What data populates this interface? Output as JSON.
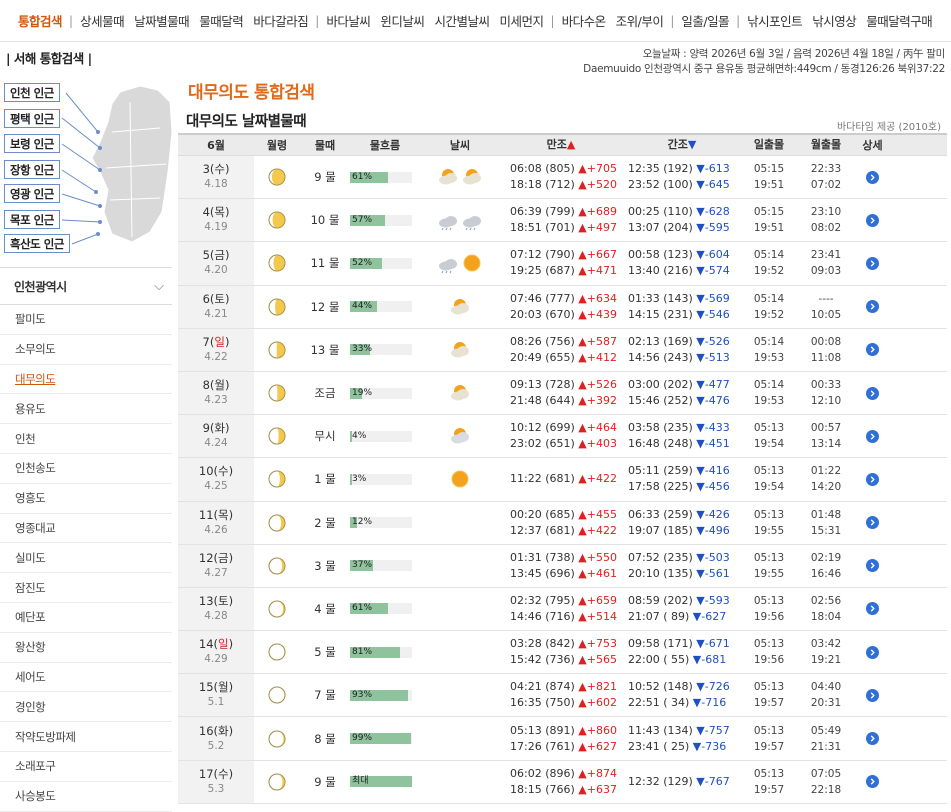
{
  "nav": [
    "통합검색",
    "상세물때",
    "날짜별물때",
    "물때달력",
    "바다갈라짐",
    "바다날씨",
    "윈디날씨",
    "시간별날씨",
    "미세먼지",
    "바다수온",
    "조위/부이",
    "일출/일몰",
    "낚시포인트",
    "낚시영상",
    "물때달력구매"
  ],
  "sidebar": {
    "title": "서해 통합검색",
    "map_labels": [
      "인천 인근",
      "평택 인근",
      "보령 인근",
      "장항 인근",
      "영광 인근",
      "목포 인근",
      "흑산도 인근"
    ],
    "region": "인천광역시",
    "locations": [
      "팔미도",
      "소무의도",
      "대무의도",
      "용유도",
      "인천",
      "인천송도",
      "영흥도",
      "영종대교",
      "실미도",
      "잠진도",
      "예단포",
      "왕산항",
      "세어도",
      "경인항",
      "작약도방파제",
      "소래포구",
      "사승봉도"
    ]
  },
  "header": {
    "date_line": "오늘날짜 : 양력 2026년 6월 3일 / 음력 2026년 4월 18일 / 丙午 팔미",
    "loc_line": "Daemuuido 인천광역시 중구 용유동 평균해면하:449cm / 동경126:26 북위37:22",
    "title": "대무의도 통합검색",
    "subtitle": "대무의도 날짜별물때",
    "credit": "바다타임 제공 (2010호)"
  },
  "table": {
    "headers": {
      "month": "6월",
      "moon": "월령",
      "tide": "물때",
      "flow": "물흐름",
      "weather": "날씨",
      "high": "만조",
      "low": "간조",
      "sun": "일출몰",
      "moonrs": "월출몰",
      "detail": "상세"
    },
    "rows": [
      {
        "day": "3(수)",
        "lunar": "4.18",
        "phase": 0.82,
        "tide": "9 물",
        "flow": "61%",
        "flow_pct": 61,
        "wx": [
          "cloud-sun",
          "cloud-sun"
        ],
        "h1": "06:08 (805)",
        "h1c": "▲+705",
        "h2": "18:18 (712)",
        "h2c": "▲+520",
        "l1": "12:35 (192)",
        "l1c": "▼-613",
        "l2": "23:52 (100)",
        "l2c": "▼-645",
        "sunr": "05:15",
        "suns": "19:51",
        "moonr": "22:33",
        "moons": "07:02"
      },
      {
        "day": "4(목)",
        "lunar": "4.19",
        "phase": 0.78,
        "tide": "10 물",
        "flow": "57%",
        "flow_pct": 57,
        "wx": [
          "cloud-rain",
          "cloud-rain"
        ],
        "h1": "06:39 (799)",
        "h1c": "▲+689",
        "h2": "18:51 (701)",
        "h2c": "▲+497",
        "l1": "00:25 (110)",
        "l1c": "▼-628",
        "l2": "13:07 (204)",
        "l2c": "▼-595",
        "sunr": "05:15",
        "suns": "19:51",
        "moonr": "23:10",
        "moons": "08:02"
      },
      {
        "day": "5(금)",
        "lunar": "4.20",
        "phase": 0.72,
        "tide": "11 물",
        "flow": "52%",
        "flow_pct": 52,
        "wx": [
          "cloud-rain",
          "sun"
        ],
        "h1": "07:12 (790)",
        "h1c": "▲+667",
        "h2": "19:25 (687)",
        "h2c": "▲+471",
        "l1": "00:58 (123)",
        "l1c": "▼-604",
        "l2": "13:40 (216)",
        "l2c": "▼-574",
        "sunr": "05:14",
        "suns": "19:52",
        "moonr": "23:41",
        "moons": "09:03"
      },
      {
        "day": "6(토)",
        "lunar": "4.21",
        "phase": 0.62,
        "tide": "12 물",
        "flow": "44%",
        "flow_pct": 44,
        "wx": [
          "cloud-sun"
        ],
        "h1": "07:46 (777)",
        "h1c": "▲+634",
        "h2": "20:03 (670)",
        "h2c": "▲+439",
        "l1": "01:33 (143)",
        "l1c": "▼-569",
        "l2": "14:15 (231)",
        "l2c": "▼-546",
        "sunr": "05:14",
        "suns": "19:52",
        "moonr": "----",
        "moons": "10:05"
      },
      {
        "day": "7(일)",
        "lunar": "4.22",
        "phase": 0.52,
        "tide": "13 물",
        "flow": "33%",
        "flow_pct": 33,
        "wx": [
          "cloud-sun"
        ],
        "h1": "08:26 (756)",
        "h1c": "▲+587",
        "h2": "20:49 (655)",
        "h2c": "▲+412",
        "l1": "02:13 (169)",
        "l1c": "▼-526",
        "l2": "14:56 (243)",
        "l2c": "▼-513",
        "sunr": "05:14",
        "suns": "19:53",
        "moonr": "00:08",
        "moons": "11:08"
      },
      {
        "day": "8(월)",
        "lunar": "4.23",
        "phase": 0.48,
        "tide": "조금",
        "flow": "19%",
        "flow_pct": 19,
        "wx": [
          "cloud-sun"
        ],
        "h1": "09:13 (728)",
        "h1c": "▲+526",
        "h2": "21:48 (644)",
        "h2c": "▲+392",
        "l1": "03:00 (202)",
        "l1c": "▼-477",
        "l2": "15:46 (252)",
        "l2c": "▼-476",
        "sunr": "05:14",
        "suns": "19:53",
        "moonr": "00:33",
        "moons": "12:10"
      },
      {
        "day": "9(화)",
        "lunar": "4.24",
        "phase": 0.4,
        "tide": "무시",
        "flow": "4%",
        "flow_pct": 4,
        "wx": [
          "cloud-sun-gray"
        ],
        "h1": "10:12 (699)",
        "h1c": "▲+464",
        "h2": "23:02 (651)",
        "h2c": "▲+403",
        "l1": "03:58 (235)",
        "l1c": "▼-433",
        "l2": "16:48 (248)",
        "l2c": "▼-451",
        "sunr": "05:13",
        "suns": "19:54",
        "moonr": "00:57",
        "moons": "13:14"
      },
      {
        "day": "10(수)",
        "lunar": "4.25",
        "phase": 0.32,
        "tide": "1 물",
        "flow": "3%",
        "flow_pct": 3,
        "wx": [
          "sun"
        ],
        "h1": "11:22 (681)",
        "h1c": "▲+422",
        "h2": "",
        "h2c": "",
        "l1": "05:11 (259)",
        "l1c": "▼-416",
        "l2": "17:58 (225)",
        "l2c": "▼-456",
        "sunr": "05:13",
        "suns": "19:54",
        "moonr": "01:22",
        "moons": "14:20"
      },
      {
        "day": "11(목)",
        "lunar": "4.26",
        "phase": 0.24,
        "tide": "2 물",
        "flow": "12%",
        "flow_pct": 12,
        "wx": [],
        "h1": "00:20 (685)",
        "h1c": "▲+455",
        "h2": "12:37 (681)",
        "h2c": "▲+422",
        "l1": "06:33 (259)",
        "l1c": "▼-426",
        "l2": "19:07 (185)",
        "l2c": "▼-496",
        "sunr": "05:13",
        "suns": "19:55",
        "moonr": "01:48",
        "moons": "15:31"
      },
      {
        "day": "12(금)",
        "lunar": "4.27",
        "phase": 0.18,
        "tide": "3 물",
        "flow": "37%",
        "flow_pct": 37,
        "wx": [],
        "h1": "01:31 (738)",
        "h1c": "▲+550",
        "h2": "13:45 (696)",
        "h2c": "▲+461",
        "l1": "07:52 (235)",
        "l1c": "▼-503",
        "l2": "20:10 (135)",
        "l2c": "▼-561",
        "sunr": "05:13",
        "suns": "19:55",
        "moonr": "02:19",
        "moons": "16:46"
      },
      {
        "day": "13(토)",
        "lunar": "4.28",
        "phase": 0.12,
        "tide": "4 물",
        "flow": "61%",
        "flow_pct": 61,
        "wx": [],
        "h1": "02:32 (795)",
        "h1c": "▲+659",
        "h2": "14:46 (716)",
        "h2c": "▲+514",
        "l1": "08:59 (202)",
        "l1c": "▼-593",
        "l2": "21:07 ( 89)",
        "l2c": "▼-627",
        "sunr": "05:13",
        "suns": "19:56",
        "moonr": "02:56",
        "moons": "18:04"
      },
      {
        "day": "14(일)",
        "lunar": "4.29",
        "phase": 0.05,
        "tide": "5 물",
        "flow": "81%",
        "flow_pct": 81,
        "wx": [],
        "h1": "03:28 (842)",
        "h1c": "▲+753",
        "h2": "15:42 (736)",
        "h2c": "▲+565",
        "l1": "09:58 (171)",
        "l1c": "▼-671",
        "l2": "22:00 ( 55)",
        "l2c": "▼-681",
        "sunr": "05:13",
        "suns": "19:56",
        "moonr": "03:42",
        "moons": "19:21"
      },
      {
        "day": "15(월)",
        "lunar": "5.1",
        "phase": 0.04,
        "tide": "7 물",
        "flow": "93%",
        "flow_pct": 93,
        "wx": [],
        "h1": "04:21 (874)",
        "h1c": "▲+821",
        "h2": "16:35 (750)",
        "h2c": "▲+602",
        "l1": "10:52 (148)",
        "l1c": "▼-726",
        "l2": "22:51 ( 34)",
        "l2c": "▼-716",
        "sunr": "05:13",
        "suns": "19:57",
        "moonr": "04:40",
        "moons": "20:31"
      },
      {
        "day": "16(화)",
        "lunar": "5.2",
        "phase": 0.1,
        "tide": "8 물",
        "flow": "99%",
        "flow_pct": 99,
        "wx": [],
        "h1": "05:13 (891)",
        "h1c": "▲+860",
        "h2": "17:26 (761)",
        "h2c": "▲+627",
        "l1": "11:43 (134)",
        "l1c": "▼-757",
        "l2": "23:41 ( 25)",
        "l2c": "▼-736",
        "sunr": "05:13",
        "suns": "19:57",
        "moonr": "05:49",
        "moons": "21:31"
      },
      {
        "day": "17(수)",
        "lunar": "5.3",
        "phase": 0.16,
        "tide": "9 물",
        "flow": "최대",
        "flow_pct": 100,
        "wx": [],
        "h1": "06:02 (896)",
        "h1c": "▲+874",
        "h2": "18:15 (766)",
        "h2c": "▲+637",
        "l1": "12:32 (129)",
        "l1c": "▼-767",
        "l2": "",
        "l2c": "",
        "sunr": "05:13",
        "suns": "19:57",
        "moonr": "07:05",
        "moons": "22:18"
      }
    ]
  }
}
